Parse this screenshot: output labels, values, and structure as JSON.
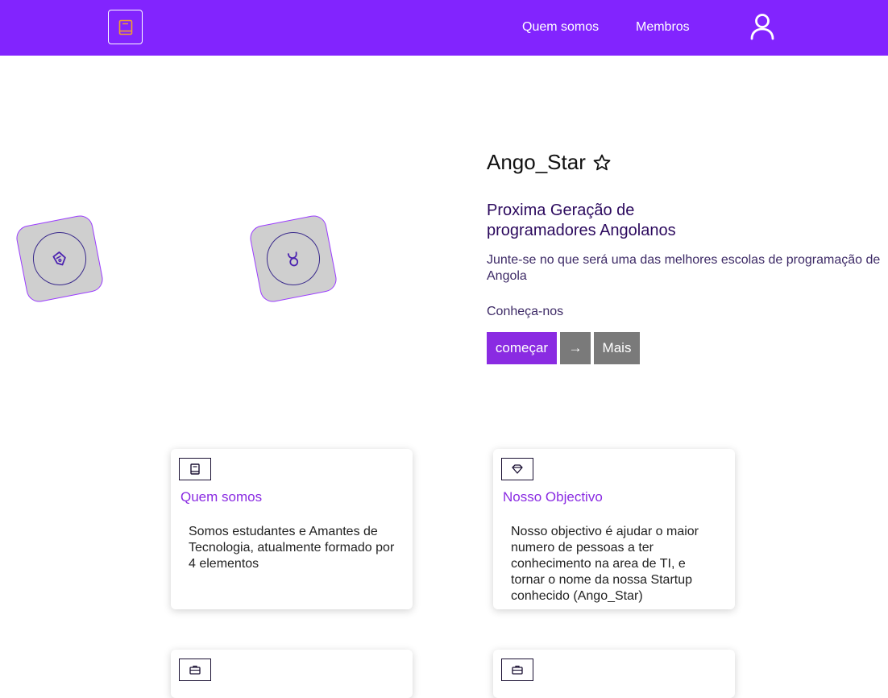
{
  "navbar": {
    "logo_icon": "book-icon",
    "links": [
      "Quem somos",
      "Membros"
    ],
    "user_icon": "user-icon",
    "background": "#8224fe"
  },
  "hero": {
    "title": "Ango_Star",
    "title_icon": "star-outline-icon",
    "subtitle": "Proxima Geração de programadores Angolanos",
    "description": "Junte-se no que será uma das melhores escolas de programação de Angola",
    "cta_label": "Conheça-nos",
    "buttons": {
      "start": "começar",
      "arrow": "→",
      "more": "Mais"
    },
    "tiles": [
      {
        "icon": "pen-nib-icon"
      },
      {
        "icon": "taurus-icon"
      }
    ]
  },
  "cards": [
    {
      "icon": "book-icon",
      "title": "Quem somos",
      "text": "Somos estudantes e Amantes de Tecnologia, atualmente formado por 4 elementos"
    },
    {
      "icon": "gem-icon",
      "title": "Nosso Objectivo",
      "text": "Nosso objectivo é ajudar o maior numero de pessoas a ter conhecimento na area de TI, e tornar o nome da nossa Startup conhecido (Ango_Star)"
    },
    {
      "icon": "briefcase-icon"
    },
    {
      "icon": "briefcase-icon"
    }
  ],
  "colors": {
    "accent": "#8a2be2",
    "button_gray": "#7a7a7a",
    "tile_gray": "#cfcfcf"
  }
}
